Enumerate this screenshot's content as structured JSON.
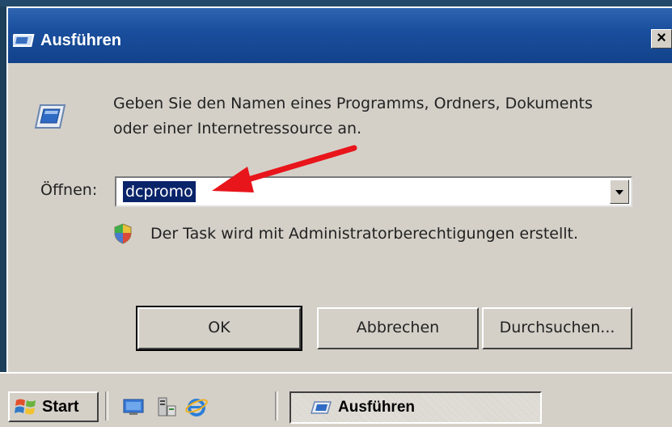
{
  "window": {
    "title": "Ausführen",
    "close_glyph": "×",
    "description": "Geben Sie den Namen eines Programms, Ordners, Dokuments oder einer Internetressource an.",
    "open_label": "Öffnen:",
    "open_value": "dcpromo",
    "admin_note": "Der Task wird mit Administratorberechtigungen erstellt.",
    "buttons": {
      "ok": "OK",
      "cancel": "Abbrechen",
      "browse": "Durchsuchen..."
    },
    "icons": [
      "run-icon",
      "shield-icon",
      "chevron-down-icon"
    ]
  },
  "taskbar": {
    "start_label": "Start",
    "quick_launch": [
      "show-desktop-icon",
      "server-manager-icon",
      "internet-explorer-icon"
    ],
    "tasks": [
      {
        "label": "Ausführen",
        "icon": "run-icon"
      }
    ]
  },
  "annotation": {
    "type": "red-arrow",
    "color": "#e8151b"
  },
  "colors": {
    "title_bar": "#1a4f9e",
    "dialog_bg": "#d4d0c8",
    "selection": "#0a246a",
    "desktop": "#1e3f5a"
  }
}
